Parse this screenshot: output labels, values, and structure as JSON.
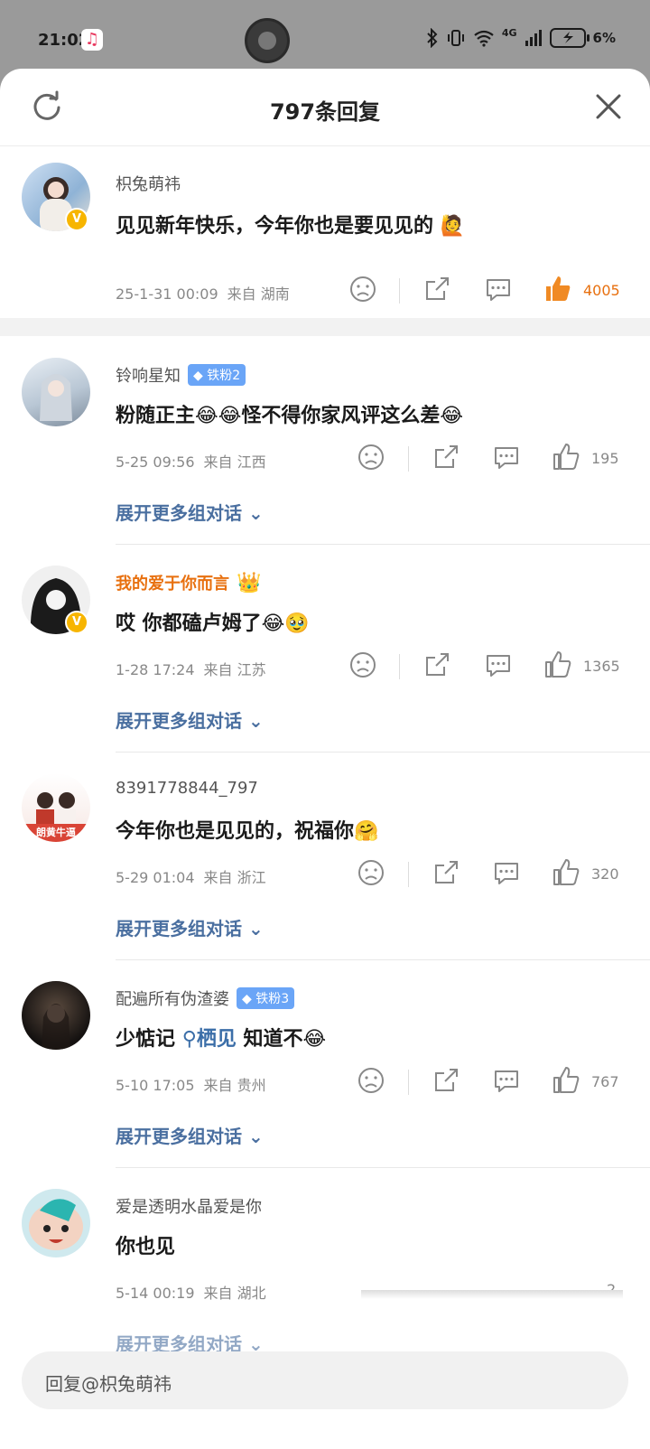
{
  "status_bar": {
    "time": "21:02",
    "battery_text": "6%",
    "network": "4G"
  },
  "sheet": {
    "title": "797条回复"
  },
  "comments": [
    {
      "username": "枳兔萌祎",
      "badge": "",
      "text": "见见新年快乐，今年你也是要见见的",
      "emoji": "🙋",
      "date": "25-1-31 00:09",
      "location": "来自 湖南",
      "likes": "4005",
      "liked": true
    },
    {
      "username": "铃响星知",
      "badge": "铁粉2",
      "text": "粉随正主😂😂怪不得你家风评这么差😂",
      "date": "5-25 09:56",
      "location": "来自 江西",
      "likes": "195",
      "expand": "展开更多组对话"
    },
    {
      "username": "我的爱于你而言",
      "badge": "",
      "text": "哎 你都磕卢姆了😂🥹",
      "date": "1-28 17:24",
      "location": "来自 江苏",
      "likes": "1365",
      "expand": "展开更多组对话"
    },
    {
      "username": "8391778844_797",
      "badge": "",
      "text": "今年你也是见见的，祝福你🤗",
      "date": "5-29 01:04",
      "location": "来自 浙江",
      "likes": "320",
      "expand": "展开更多组对话",
      "avatar_caption": "朗黄牛逼"
    },
    {
      "username": "配遍所有伪渣婆",
      "badge": "铁粉3",
      "text_prefix": "少惦记",
      "text_link": "栖见",
      "text_suffix": " 知道不😂",
      "date": "5-10 17:05",
      "location": "来自 贵州",
      "likes": "767",
      "expand": "展开更多组对话"
    },
    {
      "username": "爱是透明水晶爱是你",
      "badge": "",
      "text": "你也见",
      "date": "5-14 00:19",
      "location": "来自 湖北",
      "likes": "2",
      "expand": "展开更多组对话"
    }
  ],
  "reply_bar": {
    "placeholder": "回复@枳兔萌祎"
  },
  "colors": {
    "accent_orange": "#e8700f",
    "link_blue": "#4a6fa0",
    "fan_badge": "#6aa5f7",
    "verified": "#f7b500"
  }
}
